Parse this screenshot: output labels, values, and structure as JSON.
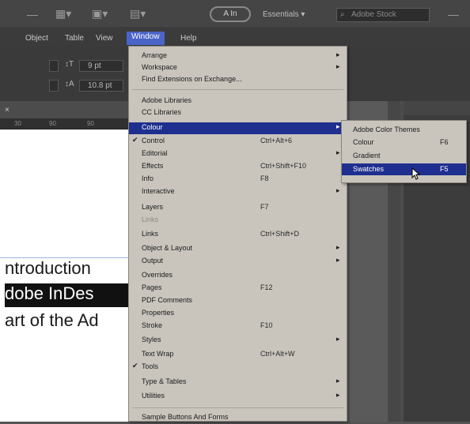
{
  "menubar": {
    "items": [
      "Object",
      "Table",
      "View",
      "Window",
      "Help"
    ]
  },
  "topbar": {
    "zoom_pill": "A In",
    "workspace": "Essentials",
    "search_placeholder": "Adobe Stock"
  },
  "control": {
    "font_size_value": "9 pt",
    "leading_value": "10.8 pt"
  },
  "ruler": {
    "ticks": [
      "30",
      "90",
      "90"
    ]
  },
  "document": {
    "line1": "ntroduction",
    "line2": "dobe InDes",
    "line3": "art of the Ad"
  },
  "window_menu": {
    "items": [
      {
        "label": "Arrange",
        "submenu": true
      },
      {
        "label": "Workspace",
        "submenu": true
      },
      {
        "label": "Find Extensions on Exchange..."
      },
      {
        "sep": true
      },
      {
        "label": "Adobe Libraries"
      },
      {
        "label": "CC Libraries"
      },
      {
        "label": "Colour",
        "submenu": true,
        "highlighted": true
      },
      {
        "label": "Control",
        "shortcut": "Ctrl+Alt+6",
        "checked": true
      },
      {
        "label": "Editorial",
        "submenu": true
      },
      {
        "label": "Effects",
        "shortcut": "Ctrl+Shift+F10"
      },
      {
        "label": "Info",
        "shortcut": "F8"
      },
      {
        "label": "Interactive",
        "submenu": true
      },
      {
        "label": "Layers",
        "shortcut": "F7"
      },
      {
        "label": "Links",
        "disabled": true
      },
      {
        "label": "Links",
        "shortcut": "Ctrl+Shift+D"
      },
      {
        "label": "Object & Layout",
        "submenu": true
      },
      {
        "label": "Output",
        "submenu": true
      },
      {
        "label": "Overrides"
      },
      {
        "label": "Pages",
        "shortcut": "F12"
      },
      {
        "label": "PDF Comments"
      },
      {
        "label": "Properties"
      },
      {
        "label": "Stroke",
        "shortcut": "F10"
      },
      {
        "label": "Styles",
        "submenu": true
      },
      {
        "label": "Text Wrap",
        "shortcut": "Ctrl+Alt+W"
      },
      {
        "label": "Tools",
        "checked": true
      },
      {
        "label": "Type & Tables",
        "submenu": true
      },
      {
        "label": "Utilities",
        "submenu": true
      },
      {
        "sep": true
      },
      {
        "label": "Sample Buttons And Forms"
      }
    ]
  },
  "colour_submenu": {
    "items": [
      {
        "label": "Adobe Color Themes"
      },
      {
        "label": "Colour",
        "shortcut": "F6"
      },
      {
        "label": "Gradient"
      },
      {
        "label": "Swatches",
        "shortcut": "F5",
        "highlighted": true
      }
    ]
  }
}
